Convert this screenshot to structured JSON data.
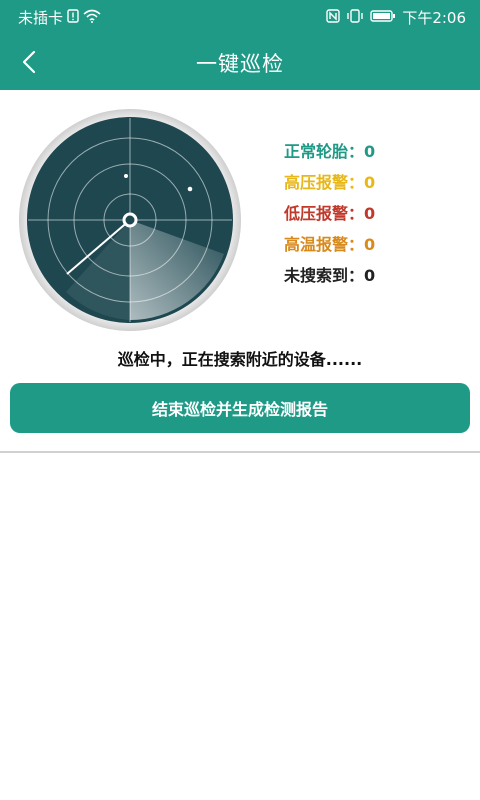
{
  "status_bar": {
    "carrier": "未插卡",
    "time": "下午2:06",
    "icons": [
      "sim-alert-icon",
      "wifi-icon",
      "nfc-icon",
      "vibrate-icon",
      "battery-icon"
    ]
  },
  "header": {
    "title": "一键巡检",
    "back_icon": "back-arrow-icon"
  },
  "stats": [
    {
      "label": "正常轮胎：",
      "value": "0",
      "color": "#1f9a86"
    },
    {
      "label": "高压报警：",
      "value": "0",
      "color": "#e8b718"
    },
    {
      "label": "低压报警：",
      "value": "0",
      "color": "#c0392b"
    },
    {
      "label": "高温报警：",
      "value": "0",
      "color": "#d98a1c"
    },
    {
      "label": "未搜索到：",
      "value": "0",
      "color": "#222222"
    }
  ],
  "scanning_text": "巡检中，正在搜索附近的设备......",
  "end_button_label": "结束巡检并生成检测报告",
  "colors": {
    "accent": "#1f9a86",
    "radar_bg": "#1e4750"
  }
}
